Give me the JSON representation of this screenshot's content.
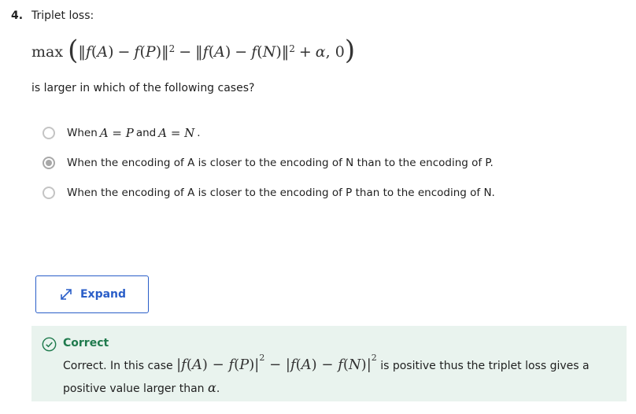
{
  "question": {
    "number": "4.",
    "title": "Triplet loss:",
    "formula_text": "max(‖f(A) − f(P)‖² − ‖f(A) − f(N)‖² + α, 0)",
    "prompt": "is larger in which of the following cases?"
  },
  "options": [
    {
      "label_prefix": "When",
      "math_a": "A = P",
      "connector": "and",
      "math_b": "A = N",
      "suffix": ".",
      "selected": false
    },
    {
      "label": "When the encoding of A is closer to the encoding of N than to the encoding of P.",
      "selected": true
    },
    {
      "label": "When the encoding of A is closer to the encoding of P than to the encoding of N.",
      "selected": false
    }
  ],
  "expand_button": {
    "label": "Expand",
    "icon": "expand-arrows-icon"
  },
  "feedback": {
    "status": "Correct",
    "text_before": "Correct. In this case",
    "formula_text": "|f(A) − f(P)|² − |f(A) − f(N)|²",
    "text_after": "is positive thus the triplet loss gives a positive value larger than",
    "alpha": "α",
    "end": ".",
    "icon": "check-circle-icon"
  },
  "colors": {
    "accent": "#2a5ec8",
    "success": "#1f7a4d",
    "feedback_bg": "#e9f3ee",
    "radio": "#a8a8a8"
  }
}
